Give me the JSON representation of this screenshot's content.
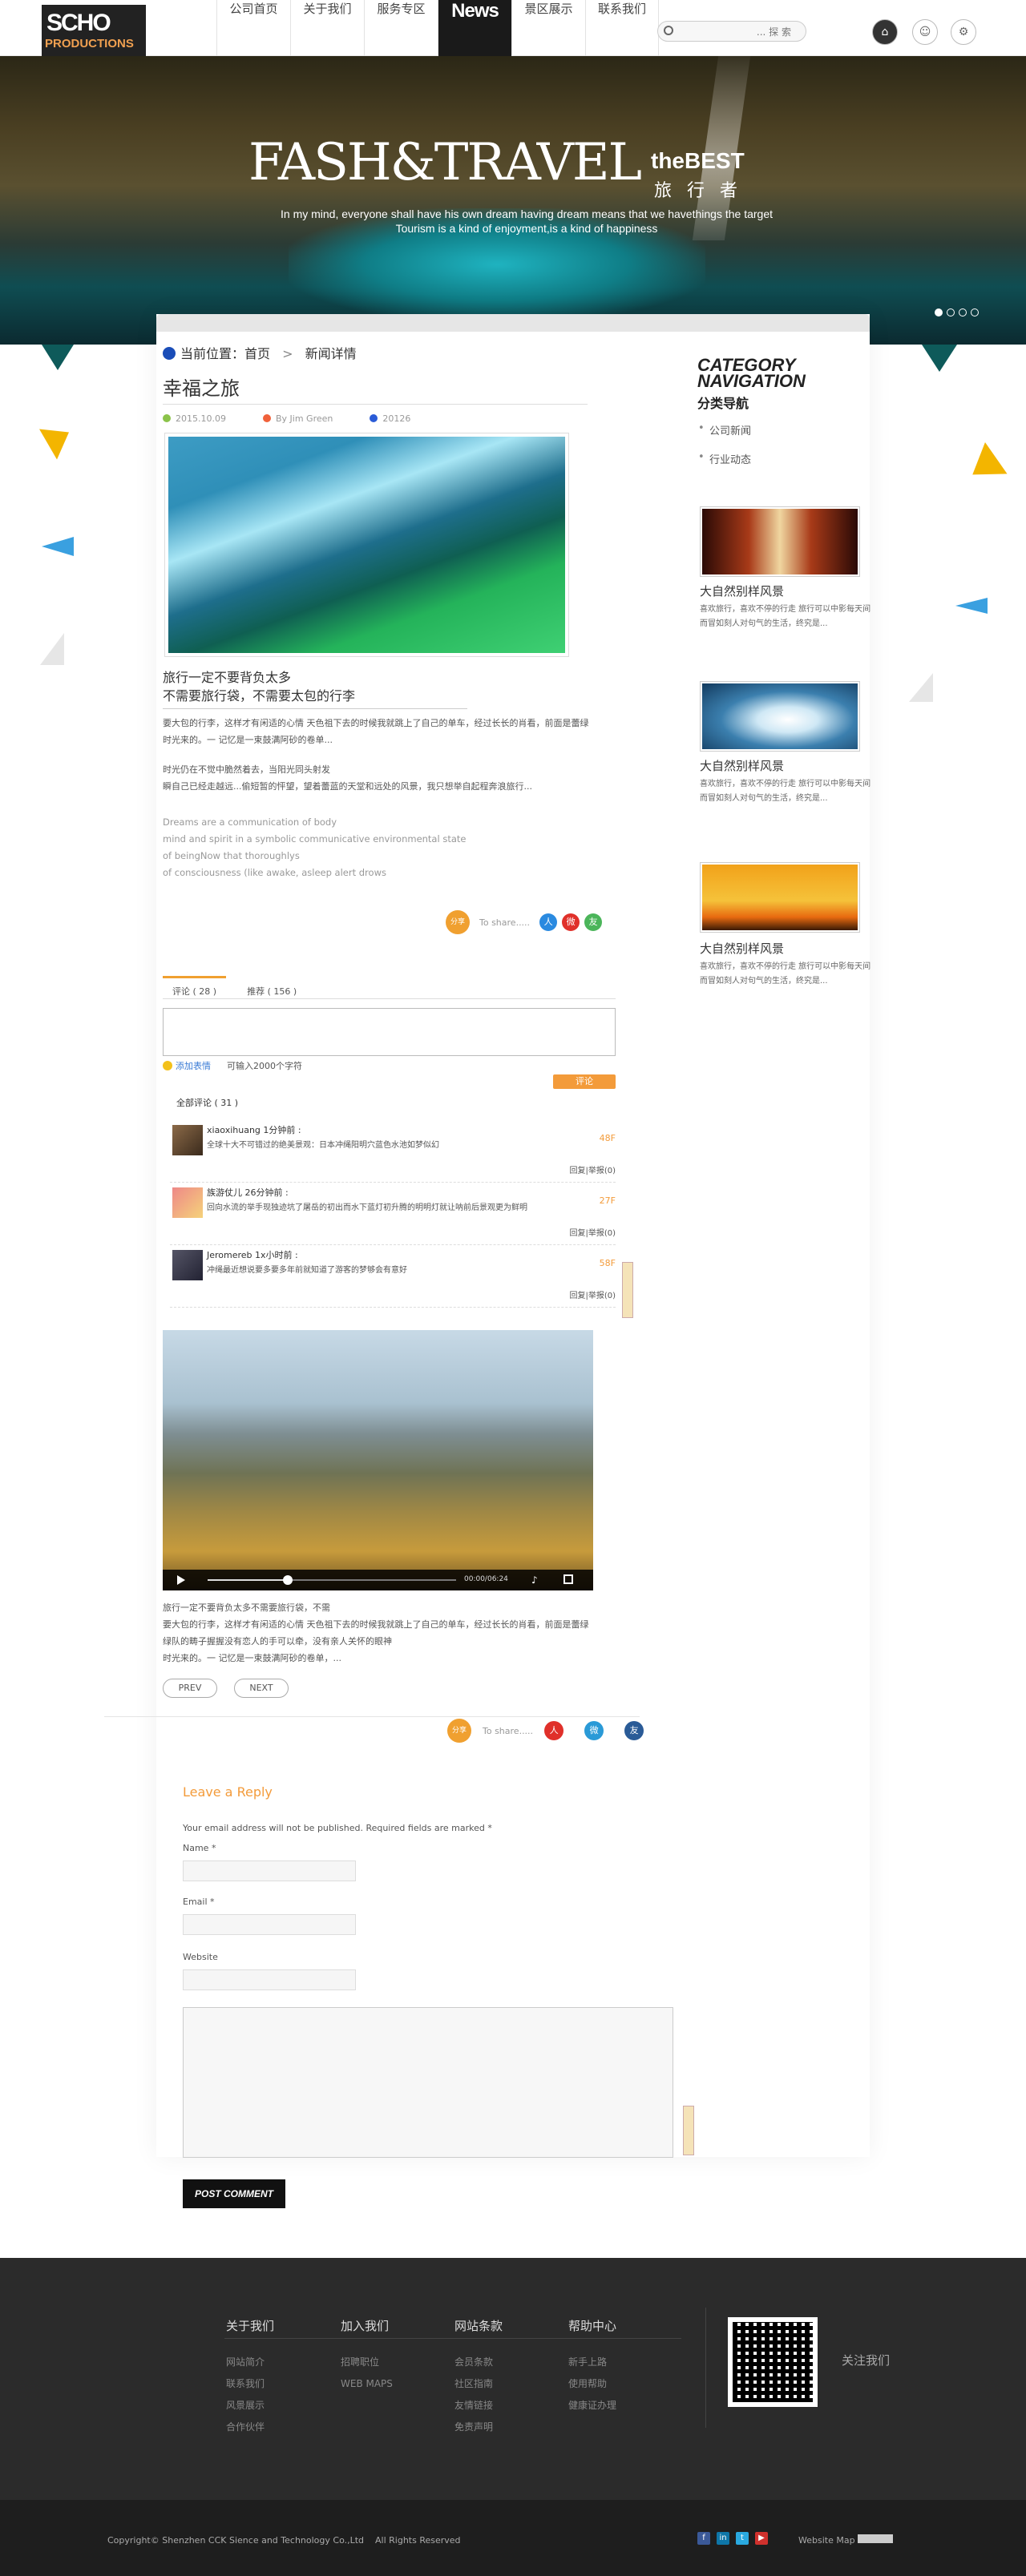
{
  "header": {
    "logo_top": "SCHO",
    "logo_bottom": "PRODUCTIONS",
    "nav": [
      "公司首页",
      "关于我们",
      "服务专区",
      "News",
      "景区展示",
      "联系我们"
    ],
    "search_label": "... 探 索"
  },
  "hero": {
    "title": "FASH&TRAVEL",
    "best": "theBEST",
    "cn": "旅 行 者",
    "sub1": "In my mind, everyone shall have his own dream having  dream means  that we havethings the target",
    "sub2": "Tourism is a kind of enjoyment,is a kind of happiness"
  },
  "breadcrumb": {
    "prefix": "当前位置：首页",
    "sep": ">",
    "current": "新闻详情"
  },
  "article": {
    "title": "幸福之旅",
    "meta_date": "2015.10.09",
    "meta_author": "By Jim Green",
    "meta_views": "20126",
    "lead1": "旅行一定不要背负太多",
    "lead2": "不需要旅行袋，不需要太包的行李",
    "p1a": "要大包的行李，这样才有闲适的心情 天色祖下去的时候我就跳上了自己的单车，经过长长的肖看，前面是蕾绿",
    "p1b": "时光来的。一 记忆是一束鼓满阿砂的卷单...",
    "p2a": "时光仍在不觉中脆然着去，当阳光同头射发",
    "p2b": "瞬自己已经走越远...偷短暂的怦望，望着蕾蓝的天堂和远处的风景，我只想举自起程奔浪旅行...",
    "e1": "Dreams are a communication of body",
    "e2": "mind and spirit in a symbolic communicative environmental state",
    "e3": "of beingNow that  thoroughlys",
    "e4": "of consciousness (like awake, asleep alert drows"
  },
  "share": {
    "orb": "分享",
    "label": "To share.....",
    "icons": [
      "人",
      "微",
      "友"
    ]
  },
  "comments": {
    "tab1": "评论 ( 28 )",
    "tab2": "推荐 ( 156 )",
    "emoji": "添加表情",
    "limit": "可输入2000个字符",
    "submit": "评论",
    "total": "全部评论 ( 31 )",
    "items": [
      {
        "name": "xiaoxihuang   1分钟前 :",
        "text": "全球十大不可错过的绝美景观：日本冲绳阳明穴蓝色水池如梦似幻",
        "floor": "48F",
        "reply": "回复|举报(0)"
      },
      {
        "name": "族游仗儿  26分钟前 :",
        "text": "回向水流的举手现独迹坑了屠岳的初出而水下蓝灯初升腾的明明灯就让呐前后景观更为鲜明",
        "floor": "27F",
        "reply": "回复|举报(0)"
      },
      {
        "name": "Jeromereb   1x小时前 :",
        "text": "冲绳最近想说要多要多年前就知道了游客的梦够会有意好",
        "floor": "58F",
        "reply": "回复|举报(0)"
      }
    ]
  },
  "video": {
    "time": "00:00/06:24"
  },
  "after_video": {
    "a": "旅行一定不要背负太多不需要旅行袋，不需",
    "b": "要大包的行李，这样才有闲适的心情 天色祖下去的时候我就跳上了自己的单车，经过长长的肖看，前面是蕾绿",
    "c": "绿队的畴子握握没有恋人的手可以牵，没有亲人关怀的眼神",
    "d": "时光来的。一 记忆是一束鼓满阿砂的卷单，..."
  },
  "pager": {
    "prev": "PREV",
    "next": "NEXT"
  },
  "reply": {
    "title": "Leave a Reply",
    "note": "Your email address will not be published. Required fields are marked *",
    "name": "Name *",
    "email": "Email *",
    "website": "Website",
    "button": "POST COMMENT"
  },
  "sidebar": {
    "h1": "CATEGORY",
    "h2": "NAVIGATION",
    "h3": "分类导航",
    "links": [
      "公司新闻",
      "行业动态"
    ],
    "items": [
      {
        "title": "大自然别样风景",
        "desc": "喜欢旅行，喜欢不停的行走 旅行可以中影每天间而冒如刻人对句气的生活，终究是..."
      },
      {
        "title": "大自然别样风景",
        "desc": "喜欢旅行，喜欢不停的行走 旅行可以中影每天间而冒如刻人对句气的生活，终究是..."
      },
      {
        "title": "大自然别样风景",
        "desc": "喜欢旅行，喜欢不停的行走 旅行可以中影每天间而冒如刻人对句气的生活，终究是..."
      }
    ]
  },
  "footer": {
    "cols": [
      {
        "h": "关于我们",
        "items": [
          "网站简介",
          "联系我们",
          "风景展示",
          "合作伙伴"
        ]
      },
      {
        "h": "加入我们",
        "items": [
          "招聘职位",
          "WEB MAPS"
        ]
      },
      {
        "h": "网站条款",
        "items": [
          "会员条款",
          "社区指南",
          "友情链接",
          "免责声明"
        ]
      },
      {
        "h": "帮助中心",
        "items": [
          "新手上路",
          "使用帮助",
          "健康证办理"
        ]
      }
    ],
    "follow": "关注我们",
    "copyright": "Copyright© Shenzhen CCK Sience and Technology Co.,Ltd",
    "rights": "All Rights Reserved",
    "webmap": "Website Map",
    "social": [
      "f",
      "in",
      "t",
      "▶"
    ]
  },
  "colors": {
    "accent": "#f39b3a",
    "dark": "#2b2b2b"
  }
}
